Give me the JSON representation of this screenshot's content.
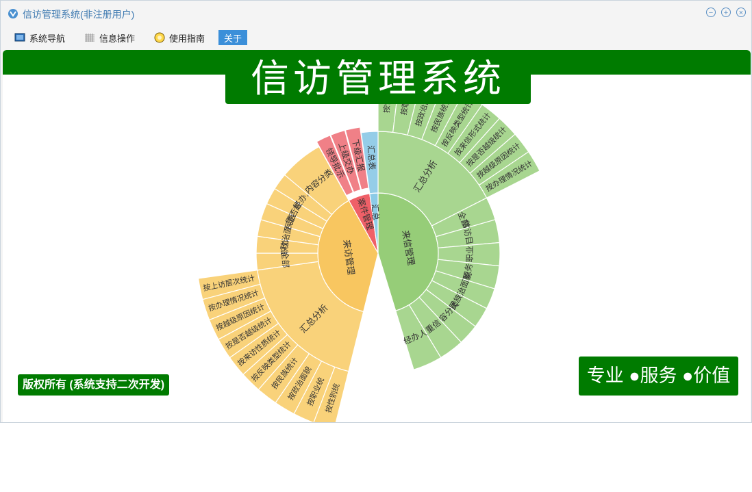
{
  "window": {
    "title": "信访管理系统(非注册用户)",
    "controls": [
      "minimize",
      "restore",
      "close"
    ]
  },
  "menu": {
    "items": [
      {
        "label": "系统导航",
        "icon": "navigation-icon"
      },
      {
        "label": "信息操作",
        "icon": "grid-icon"
      },
      {
        "label": "使用指南",
        "icon": "guide-icon"
      },
      {
        "label": "关于",
        "active": true
      }
    ]
  },
  "banner": {
    "title": "信访管理系统"
  },
  "footer": {
    "copyright": "版权所有 (系统支持二次开发)",
    "slogan": "专业 ●服务 ●价值"
  },
  "colors": {
    "brand_green": "#007b00",
    "green_inner": "#96cd78",
    "green_outer": "#a8d690",
    "orange_inner": "#f8c660",
    "orange_outer": "#f9d27a",
    "red_inner": "#ef6068",
    "red_outer": "#f08087",
    "blue_inner": "#8ccbe7",
    "blue_outer": "#95cde8"
  },
  "sunburst": {
    "inner": [
      {
        "label": "来信管理",
        "color": "green"
      },
      {
        "label": "来访管理",
        "color": "orange"
      },
      {
        "label": "案件管理",
        "color": "red"
      },
      {
        "label": "汇总",
        "color": "blue"
      }
    ],
    "middle": [
      {
        "label": "汇总分析",
        "parent": "来信管理"
      },
      {
        "label": "全部",
        "parent": "来信管理"
      },
      {
        "label": "信访目的",
        "parent": "来信管理"
      },
      {
        "label": "职业",
        "parent": "来信管理"
      },
      {
        "label": "职务",
        "parent": "来信管理"
      },
      {
        "label": "政治面貌",
        "parent": "来信管理"
      },
      {
        "label": "民族",
        "parent": "来信管理"
      },
      {
        "label": "内容分类",
        "parent": "来信管理"
      },
      {
        "label": "重信",
        "parent": "来信管理"
      },
      {
        "label": "经办人",
        "parent": "来信管理"
      },
      {
        "label": "汇总分析",
        "parent": "来访管理"
      },
      {
        "label": "全部",
        "parent": "来访管理"
      },
      {
        "label": "职业",
        "parent": "来访管理"
      },
      {
        "label": "政治面貌",
        "parent": "来访管理"
      },
      {
        "label": "民族",
        "parent": "来访管理"
      },
      {
        "label": "是否越级",
        "parent": "来访管理"
      },
      {
        "label": "经办人",
        "parent": "来访管理"
      },
      {
        "label": "内容分类",
        "parent": "来访管理"
      },
      {
        "label": "领导批示",
        "parent": "案件管理"
      },
      {
        "label": "上级交办",
        "parent": "案件管理"
      },
      {
        "label": "下级汇报",
        "parent": "案件管理"
      },
      {
        "label": "汇总表",
        "parent": "汇总"
      }
    ],
    "outer_green": [
      "按性别",
      "按职业",
      "按政治面貌",
      "按民族统计",
      "按反映类型统计",
      "按来信形式统计",
      "按是否越级统计",
      "按越级原因统计",
      "按办理情况统计"
    ],
    "outer_orange": [
      "按上访层次统计",
      "按办理情况统计",
      "按越级原因统计",
      "按是否越级统计",
      "按来访性质统计",
      "按反映类型统计",
      "按民族统计",
      "按政治面貌",
      "按职业统",
      "按性别统"
    ]
  }
}
